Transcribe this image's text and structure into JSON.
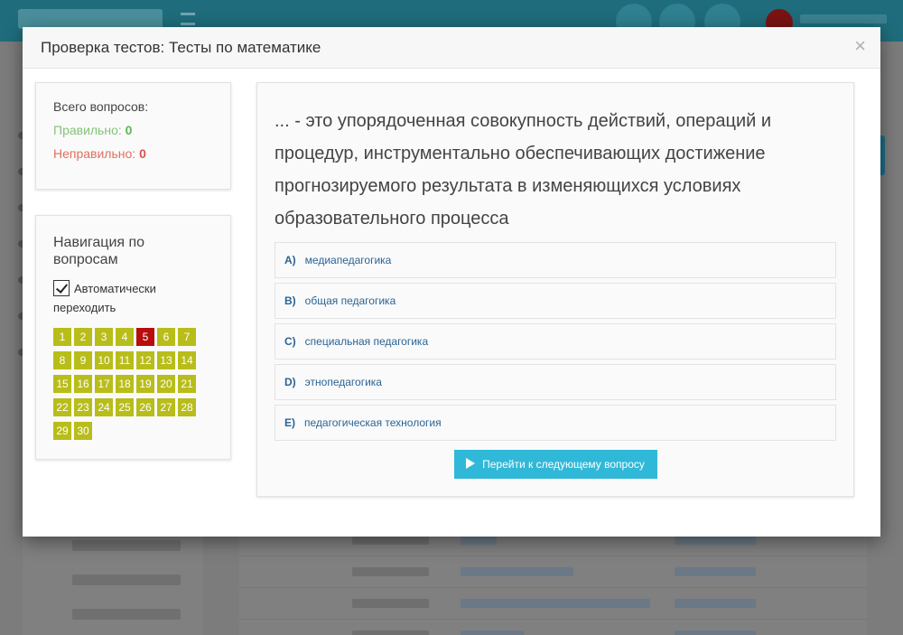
{
  "modal": {
    "title": "Проверка тестов: Тесты по математике",
    "close_label": "×"
  },
  "stats": {
    "total_label": "Всего вопросов:",
    "correct_label": "Правильно:",
    "correct_value": "0",
    "wrong_label": "Неправильно:",
    "wrong_value": "0"
  },
  "navigation": {
    "title": "Навигация по вопросам",
    "auto_label": "Автоматически переходить",
    "auto_checked": true,
    "current": 5,
    "questions": [
      "1",
      "2",
      "3",
      "4",
      "5",
      "6",
      "7",
      "8",
      "9",
      "10",
      "11",
      "12",
      "13",
      "14",
      "15",
      "16",
      "17",
      "18",
      "19",
      "20",
      "21",
      "22",
      "23",
      "24",
      "25",
      "26",
      "27",
      "28",
      "29",
      "30"
    ]
  },
  "question": {
    "text": "... - это упорядоченная совокупность действий, операций и процедур, инструментально обеспечивающих достижение прогнозируемого результата в изменяющихся условиях образовательного процесса",
    "answers": [
      {
        "letter": "A)",
        "text": "медиапедагогика"
      },
      {
        "letter": "B)",
        "text": "общая педагогика"
      },
      {
        "letter": "C)",
        "text": "специальная педагогика"
      },
      {
        "letter": "D)",
        "text": "этнопедагогика"
      },
      {
        "letter": "E)",
        "text": "педагогическая технология"
      }
    ],
    "next_label": "Перейти к следующему вопросу"
  },
  "colors": {
    "question_button": "#b8bd1a",
    "current_question": "#b80d0d",
    "correct": "#5cb85c",
    "wrong": "#d9534f",
    "primary_button": "#30b8d8"
  }
}
